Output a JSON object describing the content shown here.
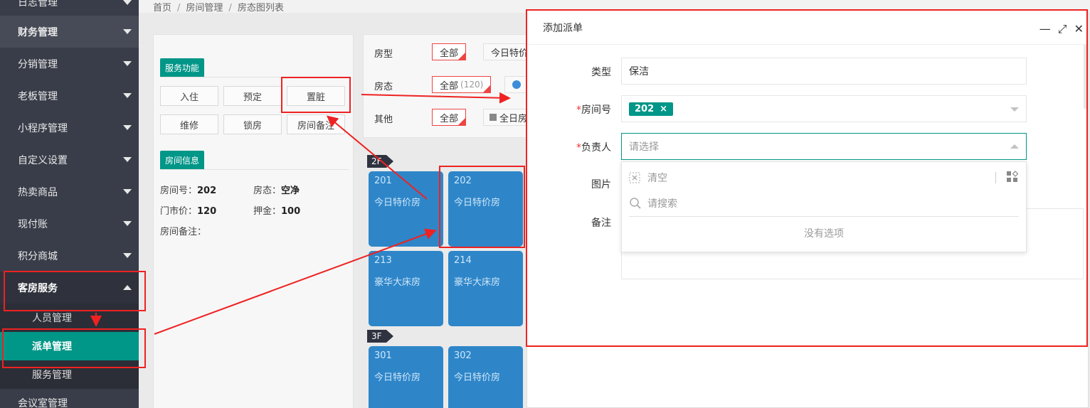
{
  "sidebar": {
    "items": [
      {
        "label": "日志管理"
      },
      {
        "label": "财务管理"
      },
      {
        "label": "分销管理"
      },
      {
        "label": "老板管理"
      },
      {
        "label": "小程序管理"
      },
      {
        "label": "自定义设置"
      },
      {
        "label": "热卖商品"
      },
      {
        "label": "现付账"
      },
      {
        "label": "积分商城"
      },
      {
        "label": "客房服务"
      }
    ],
    "sub_items": [
      {
        "label": "人员管理"
      },
      {
        "label": "派单管理"
      },
      {
        "label": "服务管理"
      }
    ],
    "cut_item": "会议室管理"
  },
  "breadcrumb": {
    "home": "首页",
    "level1": "房间管理",
    "level2": "房态图列表",
    "sep": "/"
  },
  "service_panel": {
    "tag": "服务功能",
    "buttons": [
      "入住",
      "预定",
      "置脏",
      "维修",
      "锁房",
      "房间备注"
    ],
    "info_tag": "房间信息",
    "info": {
      "room_no_label": "房间号：",
      "room_no": "202",
      "status_label": "房态：",
      "status": "空净",
      "price_label": "门市价：",
      "price": "120",
      "deposit_label": "押金：",
      "deposit": "100",
      "remark_label": "房间备注："
    }
  },
  "filter": {
    "room_type_label": "房型",
    "room_type_all": "全部",
    "room_type_special": "今日特价",
    "status_label": "房态",
    "status_all": "全部",
    "status_count": "(120)",
    "other_label": "其他",
    "other_all": "全部",
    "other_allroom": "全日房"
  },
  "floors": [
    {
      "label": "2F"
    },
    {
      "label": "3F"
    }
  ],
  "rooms": [
    {
      "no": "201",
      "type": "今日特价房"
    },
    {
      "no": "202",
      "type": "今日特价房"
    },
    {
      "no": "213",
      "type": "豪华大床房"
    },
    {
      "no": "214",
      "type": "豪华大床房"
    },
    {
      "no": "301",
      "type": "今日特价房"
    },
    {
      "no": "302",
      "type": "今日特价房"
    }
  ],
  "modal": {
    "title": "添加派单",
    "type_label": "类型",
    "type_value": "保洁",
    "room_label": "房间号",
    "room_chip": "202",
    "assignee_label": "负责人",
    "assignee_placeholder": "请选择",
    "dropdown": {
      "clear": "清空",
      "search_placeholder": "请搜索",
      "empty": "没有选项"
    },
    "image_label": "图片",
    "remark_label": "备注",
    "required_mark": "*"
  },
  "colors": {
    "sidebar": "#393d49",
    "accent": "#009688",
    "room_card": "#2e86c9",
    "annotation": "#ee2222"
  }
}
